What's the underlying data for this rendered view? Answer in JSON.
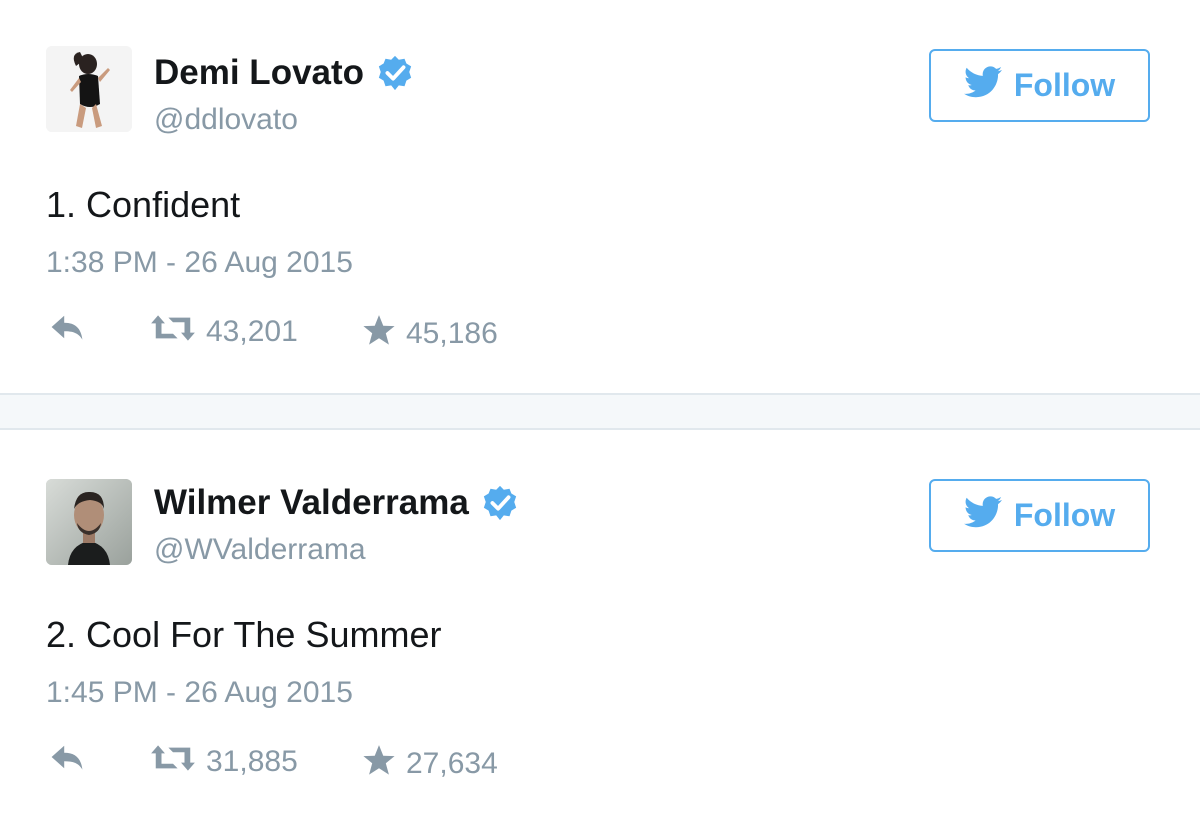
{
  "tweets": [
    {
      "name": "Demi Lovato",
      "handle": "@ddlovato",
      "text": "1. Confident",
      "timestamp": "1:38 PM - 26 Aug 2015",
      "retweets": "43,201",
      "favorites": "45,186",
      "follow_label": "Follow",
      "verified": true
    },
    {
      "name": "Wilmer Valderrama",
      "handle": "@WValderrama",
      "text": "2. Cool For The Summer",
      "timestamp": "1:45 PM - 26 Aug 2015",
      "retweets": "31,885",
      "favorites": "27,634",
      "follow_label": "Follow",
      "verified": true
    }
  ],
  "colors": {
    "twitter_blue": "#55acee",
    "gray_text": "#8899a6",
    "dark_text": "#14171a",
    "border": "#e1e8ed"
  },
  "icons": [
    "twitter-bird-icon",
    "verified-badge-icon",
    "reply-icon",
    "retweet-icon",
    "favorite-star-icon"
  ]
}
